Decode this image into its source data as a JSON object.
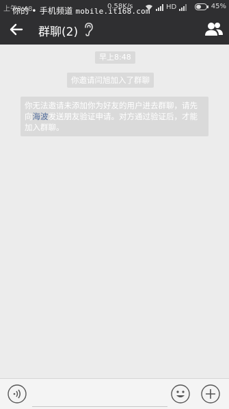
{
  "status_bar": {
    "time": "上午8:48",
    "speed": "0.58K/s",
    "network_hd": "HD",
    "battery": "45%"
  },
  "watermark": {
    "text": "你的 • 手机频道 ",
    "site": "mobile.it168.com"
  },
  "header": {
    "title": "群聊(2)",
    "icons": [
      "back-arrow-icon",
      "ear-icon",
      "group-members-icon"
    ]
  },
  "messages": {
    "timestamp": "早上8:48",
    "notice_invite": "你邀请闫旭加入了群聊",
    "notice_blocked_part1": "你无法邀请未添加你为好友的用户进去群聊，请先向",
    "notice_blocked_link": "海波",
    "notice_blocked_part2": "发送朋友验证申请。对方通过验证后，才能加入群聊。"
  },
  "input_bar": {
    "value": "",
    "icons": [
      "voice-icon",
      "emoji-icon",
      "plus-icon"
    ]
  },
  "colors": {
    "bar": "#2f2f31",
    "background": "#ececec",
    "notice_bg": "#dadada",
    "link": "#516c9b"
  }
}
